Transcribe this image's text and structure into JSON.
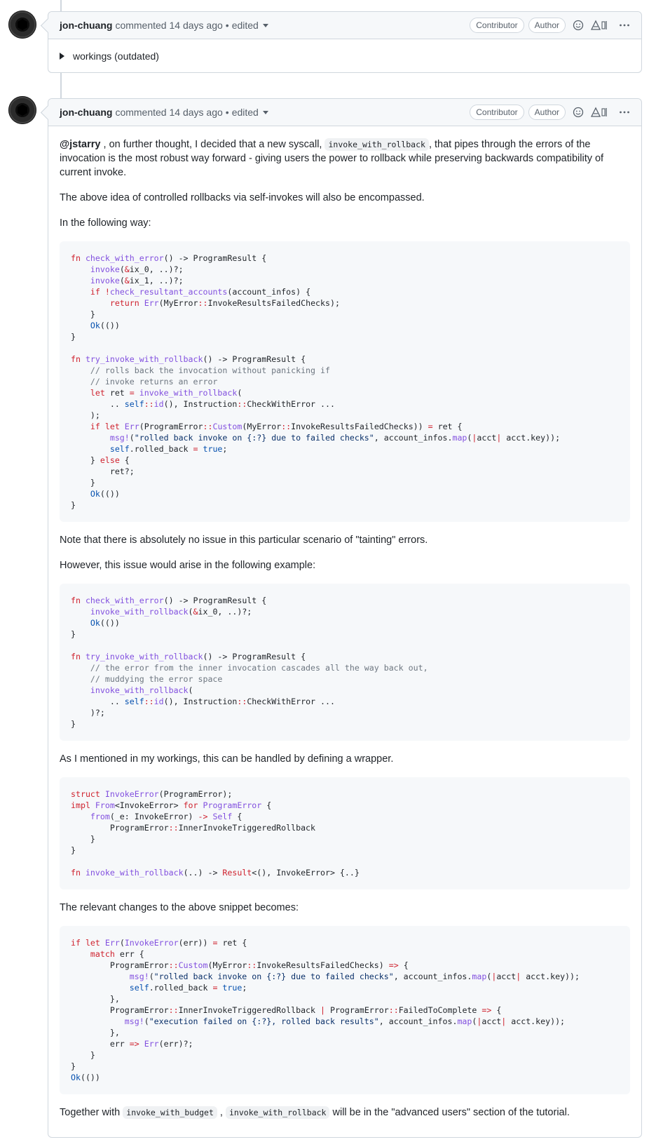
{
  "comments": [
    {
      "author": "jon-chuang",
      "action": "commented",
      "time": "14 days ago",
      "separator": "•",
      "edited": "edited",
      "badges": [
        "Contributor",
        "Author"
      ],
      "details_summary": "workings (outdated)"
    },
    {
      "author": "jon-chuang",
      "action": "commented",
      "time": "14 days ago",
      "separator": "•",
      "edited": "edited",
      "badges": [
        "Contributor",
        "Author"
      ],
      "body": {
        "p1_mention": "@jstarry",
        "p1_a": " , on further thought, I decided that a new syscall, ",
        "p1_code": "invoke_with_rollback",
        "p1_b": ", that pipes through the errors of the invocation is the most robust way forward - giving users the power to rollback while preserving backwards compatibility of current invoke.",
        "p2": "The above idea of controlled rollbacks via self-invokes will also be encompassed.",
        "p3": "In the following way:",
        "p4": "Note that there is absolutely no issue in this particular scenario of \"tainting\" errors.",
        "p5": "However, this issue would arise in the following example:",
        "p6": "As I mentioned in my workings, this can be handled by defining a wrapper.",
        "p7": "The relevant changes to the above snippet becomes:",
        "p8_a": "Together with ",
        "p8_code1": "invoke_with_budget",
        "p8_b": " , ",
        "p8_code2": "invoke_with_rollback",
        "p8_c": " will be in the \"advanced users\" section of the tutorial."
      }
    }
  ],
  "code_blocks": [
    [
      [
        [
          "k",
          "fn "
        ],
        [
          "f",
          "check_with_error"
        ],
        [
          "",
          "() -> ProgramResult {"
        ]
      ],
      [
        [
          "",
          "    "
        ],
        [
          "f",
          "invoke"
        ],
        [
          "",
          "("
        ],
        [
          "k",
          "&"
        ],
        [
          "",
          "ix_0, ..)?;"
        ]
      ],
      [
        [
          "",
          "    "
        ],
        [
          "f",
          "invoke"
        ],
        [
          "",
          "("
        ],
        [
          "k",
          "&"
        ],
        [
          "",
          "ix_1, ..)?;"
        ]
      ],
      [
        [
          "",
          "    "
        ],
        [
          "k",
          "if "
        ],
        [
          "k",
          "!"
        ],
        [
          "f",
          "check_resultant_accounts"
        ],
        [
          "",
          "(account_infos) {"
        ]
      ],
      [
        [
          "",
          "        "
        ],
        [
          "k",
          "return "
        ],
        [
          "f",
          "Err"
        ],
        [
          "",
          "(MyError"
        ],
        [
          "k",
          "::"
        ],
        [
          "",
          "InvokeResultsFailedChecks);"
        ]
      ],
      [
        [
          "",
          "    }"
        ]
      ],
      [
        [
          "",
          "    "
        ],
        [
          "b",
          "Ok"
        ],
        [
          "",
          "(())"
        ]
      ],
      [
        [
          "",
          "}"
        ]
      ],
      [
        [
          "",
          ""
        ]
      ],
      [
        [
          "k",
          "fn "
        ],
        [
          "f",
          "try_invoke_with_rollback"
        ],
        [
          "",
          "() -> ProgramResult {"
        ]
      ],
      [
        [
          "",
          "    "
        ],
        [
          "c",
          "// rolls back the invocation without panicking if"
        ]
      ],
      [
        [
          "",
          "    "
        ],
        [
          "c",
          "// invoke returns an error"
        ]
      ],
      [
        [
          "",
          "    "
        ],
        [
          "k",
          "let "
        ],
        [
          "",
          "ret "
        ],
        [
          "k",
          "= "
        ],
        [
          "f",
          "invoke_with_rollback"
        ],
        [
          "",
          "("
        ]
      ],
      [
        [
          "",
          "        .. "
        ],
        [
          "b",
          "self"
        ],
        [
          "k",
          "::"
        ],
        [
          "f",
          "id"
        ],
        [
          "",
          "(), Instruction"
        ],
        [
          "k",
          "::"
        ],
        [
          "",
          "CheckWithError ..."
        ]
      ],
      [
        [
          "",
          "    );"
        ]
      ],
      [
        [
          "",
          "    "
        ],
        [
          "k",
          "if let "
        ],
        [
          "f",
          "Err"
        ],
        [
          "",
          "(ProgramError"
        ],
        [
          "k",
          "::"
        ],
        [
          "f",
          "Custom"
        ],
        [
          "",
          "(MyError"
        ],
        [
          "k",
          "::"
        ],
        [
          "",
          "InvokeResultsFailedChecks)) "
        ],
        [
          "k",
          "= "
        ],
        [
          "",
          "ret {"
        ]
      ],
      [
        [
          "",
          "        "
        ],
        [
          "f",
          "msg!"
        ],
        [
          "",
          "("
        ],
        [
          "s",
          "\"rolled back invoke on {:?} due to failed checks\""
        ],
        [
          "",
          ", account_infos."
        ],
        [
          "f",
          "map"
        ],
        [
          "",
          "("
        ],
        [
          "k",
          "|"
        ],
        [
          "",
          "acct"
        ],
        [
          "k",
          "| "
        ],
        [
          "",
          "acct.key));"
        ]
      ],
      [
        [
          "",
          "        "
        ],
        [
          "b",
          "self"
        ],
        [
          "",
          ".rolled_back "
        ],
        [
          "k",
          "= "
        ],
        [
          "b",
          "true"
        ],
        [
          "",
          ";"
        ]
      ],
      [
        [
          "",
          "    } "
        ],
        [
          "k",
          "else "
        ],
        [
          "",
          "{"
        ]
      ],
      [
        [
          "",
          "        ret?;"
        ]
      ],
      [
        [
          "",
          "    }"
        ]
      ],
      [
        [
          "",
          "    "
        ],
        [
          "b",
          "Ok"
        ],
        [
          "",
          "(())"
        ]
      ],
      [
        [
          "",
          "}"
        ]
      ]
    ],
    [
      [
        [
          "k",
          "fn "
        ],
        [
          "f",
          "check_with_error"
        ],
        [
          "",
          "() -> ProgramResult {"
        ]
      ],
      [
        [
          "",
          "    "
        ],
        [
          "f",
          "invoke_with_rollback"
        ],
        [
          "",
          "("
        ],
        [
          "k",
          "&"
        ],
        [
          "",
          "ix_0, ..)?;"
        ]
      ],
      [
        [
          "",
          "    "
        ],
        [
          "b",
          "Ok"
        ],
        [
          "",
          "(())"
        ]
      ],
      [
        [
          "",
          "}"
        ]
      ],
      [
        [
          "",
          ""
        ]
      ],
      [
        [
          "k",
          "fn "
        ],
        [
          "f",
          "try_invoke_with_rollback"
        ],
        [
          "",
          "() -> ProgramResult {"
        ]
      ],
      [
        [
          "",
          "    "
        ],
        [
          "c",
          "// the error from the inner invocation cascades all the way back out,"
        ]
      ],
      [
        [
          "",
          "    "
        ],
        [
          "c",
          "// muddying the error space"
        ]
      ],
      [
        [
          "",
          "    "
        ],
        [
          "f",
          "invoke_with_rollback"
        ],
        [
          "",
          "("
        ]
      ],
      [
        [
          "",
          "        .. "
        ],
        [
          "b",
          "self"
        ],
        [
          "k",
          "::"
        ],
        [
          "f",
          "id"
        ],
        [
          "",
          "(), Instruction"
        ],
        [
          "k",
          "::"
        ],
        [
          "",
          "CheckWithError ..."
        ]
      ],
      [
        [
          "",
          "    )?;"
        ]
      ],
      [
        [
          "",
          "}"
        ]
      ]
    ],
    [
      [
        [
          "k",
          "struct "
        ],
        [
          "f",
          "InvokeError"
        ],
        [
          "",
          "(ProgramError);"
        ]
      ],
      [
        [
          "k",
          "impl "
        ],
        [
          "f",
          "From"
        ],
        [
          "",
          "<InvokeError> "
        ],
        [
          "k",
          "for "
        ],
        [
          "f",
          "ProgramError "
        ],
        [
          "",
          "{"
        ]
      ],
      [
        [
          "",
          "    "
        ],
        [
          "f",
          "from"
        ],
        [
          "",
          "(_e: InvokeError) "
        ],
        [
          "k",
          "-> "
        ],
        [
          "f",
          "Self "
        ],
        [
          "",
          "{"
        ]
      ],
      [
        [
          "",
          "        ProgramError"
        ],
        [
          "k",
          "::"
        ],
        [
          "",
          "InnerInvokeTriggeredRollback"
        ]
      ],
      [
        [
          "",
          "    }"
        ]
      ],
      [
        [
          "",
          "}"
        ]
      ],
      [
        [
          "",
          ""
        ]
      ],
      [
        [
          "k",
          "fn "
        ],
        [
          "f",
          "invoke_with_rollback"
        ],
        [
          "",
          "(..) -> "
        ],
        [
          "k",
          "Result"
        ],
        [
          "",
          "<(), InvokeError> {..}"
        ]
      ]
    ],
    [
      [
        [
          "k",
          "if let "
        ],
        [
          "f",
          "Err"
        ],
        [
          "",
          "("
        ],
        [
          "f",
          "InvokeError"
        ],
        [
          "",
          "(err)) "
        ],
        [
          "k",
          "= "
        ],
        [
          "",
          "ret {"
        ]
      ],
      [
        [
          "",
          "    "
        ],
        [
          "k",
          "match "
        ],
        [
          "",
          "err {"
        ]
      ],
      [
        [
          "",
          "        ProgramError"
        ],
        [
          "k",
          "::"
        ],
        [
          "f",
          "Custom"
        ],
        [
          "",
          "(MyError"
        ],
        [
          "k",
          "::"
        ],
        [
          "",
          "InvokeResultsFailedChecks) "
        ],
        [
          "k",
          "=> "
        ],
        [
          "",
          "{"
        ]
      ],
      [
        [
          "",
          "            "
        ],
        [
          "f",
          "msg!"
        ],
        [
          "",
          "("
        ],
        [
          "s",
          "\"rolled back invoke on {:?} due to failed checks\""
        ],
        [
          "",
          ", account_infos."
        ],
        [
          "f",
          "map"
        ],
        [
          "",
          "("
        ],
        [
          "k",
          "|"
        ],
        [
          "",
          "acct"
        ],
        [
          "k",
          "| "
        ],
        [
          "",
          "acct.key));"
        ]
      ],
      [
        [
          "",
          "            "
        ],
        [
          "b",
          "self"
        ],
        [
          "",
          ".rolled_back "
        ],
        [
          "k",
          "= "
        ],
        [
          "b",
          "true"
        ],
        [
          "",
          ";"
        ]
      ],
      [
        [
          "",
          "        },"
        ]
      ],
      [
        [
          "",
          "        ProgramError"
        ],
        [
          "k",
          "::"
        ],
        [
          "",
          "InnerInvokeTriggeredRollback "
        ],
        [
          "k",
          "| "
        ],
        [
          "",
          "ProgramError"
        ],
        [
          "k",
          "::"
        ],
        [
          "",
          "FailedToComplete "
        ],
        [
          "k",
          "=> "
        ],
        [
          "",
          "{"
        ]
      ],
      [
        [
          "",
          "           "
        ],
        [
          "f",
          "msg!"
        ],
        [
          "",
          "("
        ],
        [
          "s",
          "\"execution failed on {:?}, rolled back results\""
        ],
        [
          "",
          ", account_infos."
        ],
        [
          "f",
          "map"
        ],
        [
          "",
          "("
        ],
        [
          "k",
          "|"
        ],
        [
          "",
          "acct"
        ],
        [
          "k",
          "| "
        ],
        [
          "",
          "acct.key));"
        ]
      ],
      [
        [
          "",
          "        },"
        ]
      ],
      [
        [
          "",
          "        err "
        ],
        [
          "k",
          "=> "
        ],
        [
          "f",
          "Err"
        ],
        [
          "",
          "(err)?;"
        ]
      ],
      [
        [
          "",
          "    }"
        ]
      ],
      [
        [
          "",
          "}"
        ]
      ],
      [
        [
          "b",
          "Ok"
        ],
        [
          "",
          "(())"
        ]
      ]
    ]
  ]
}
